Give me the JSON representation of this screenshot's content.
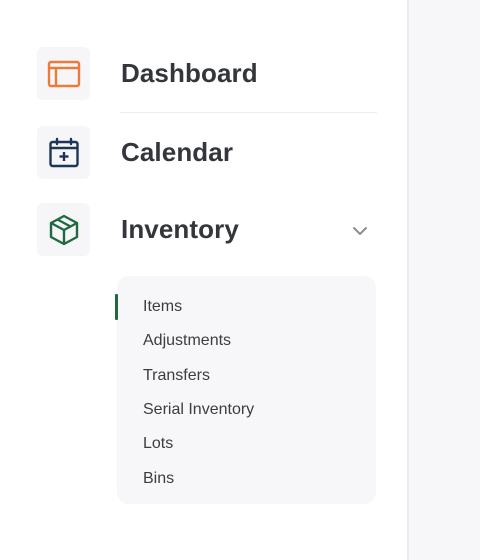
{
  "sidebar": {
    "items": [
      {
        "label": "Dashboard",
        "icon": "layout-icon",
        "icon_color": "#ee7a3a"
      },
      {
        "label": "Calendar",
        "icon": "calendar-plus-icon",
        "icon_color": "#1d3557"
      },
      {
        "label": "Inventory",
        "icon": "box-icon",
        "icon_color": "#1f6b3f",
        "expanded": true
      }
    ],
    "inventory_submenu": [
      {
        "label": "Items",
        "active": true
      },
      {
        "label": "Adjustments"
      },
      {
        "label": "Transfers"
      },
      {
        "label": "Serial Inventory"
      },
      {
        "label": "Lots"
      },
      {
        "label": "Bins"
      }
    ]
  },
  "colors": {
    "active_indicator": "#1f6b3f",
    "label_text": "#33363b"
  }
}
